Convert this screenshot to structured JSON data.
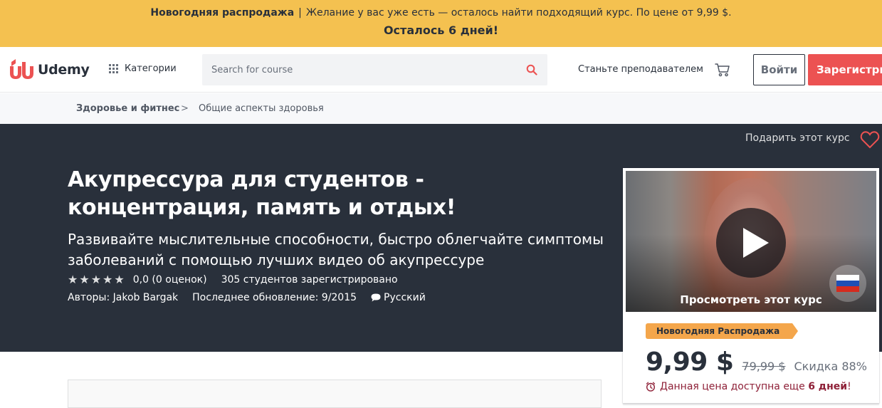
{
  "promo": {
    "bold": "Новогодняя распродажа",
    "separator": "|",
    "text": "Желание у вас уже есть — осталось найти подходящий курс. По цене от 9,99 $.",
    "countdown": "Осталось 6 дней!"
  },
  "header": {
    "logo_text": "Udemy",
    "categories_label": "Категории",
    "search_placeholder": "Search for course",
    "teach_label": "Станьте преподавателем",
    "login_label": "Войти",
    "signup_label": "Зарегистрироваться"
  },
  "breadcrumb": {
    "category": "Здоровье и фитнес",
    "arrow": ">",
    "subcategory": "Общие аспекты здоровья"
  },
  "course": {
    "gift_label": "Подарить этот курс",
    "title": "Акупрессура для студентов - концентрация, память и отдых!",
    "subtitle": "Развивайте мыслительные способности, быстро облегчайте симптомы заболеваний с помощью лучших видео об акупрессуре",
    "rating_text": "0,0 (0 оценок)",
    "rating_value": 0,
    "students": "305 студентов зарегистрировано",
    "authors": "Авторы: Jakob Bargak",
    "updated": "Последнее обновление: 9/2015",
    "language": "Русский"
  },
  "card": {
    "preview_label": "Просмотреть этот курс",
    "sale_tag": "Новогодняя Распродажа",
    "price": "9,99 $",
    "old_price": "79,99 $",
    "discount": "Скидка 88%",
    "deadline_prefix": "Данная цена доступна еще ",
    "deadline_bold": "6 дней",
    "deadline_suffix": "!"
  },
  "colors": {
    "promo_bg": "#f4c150",
    "hero_bg": "#29303b",
    "accent_red": "#ec5252",
    "sale_orange": "#f4a64b",
    "deadline_red": "#8e2037"
  },
  "icons": [
    "udemy-logo-icon",
    "grid-icon",
    "search-icon",
    "cart-icon",
    "heart-icon",
    "star-icon",
    "chat-bubble-icon",
    "play-icon",
    "russia-flag-icon",
    "alarm-clock-icon"
  ]
}
